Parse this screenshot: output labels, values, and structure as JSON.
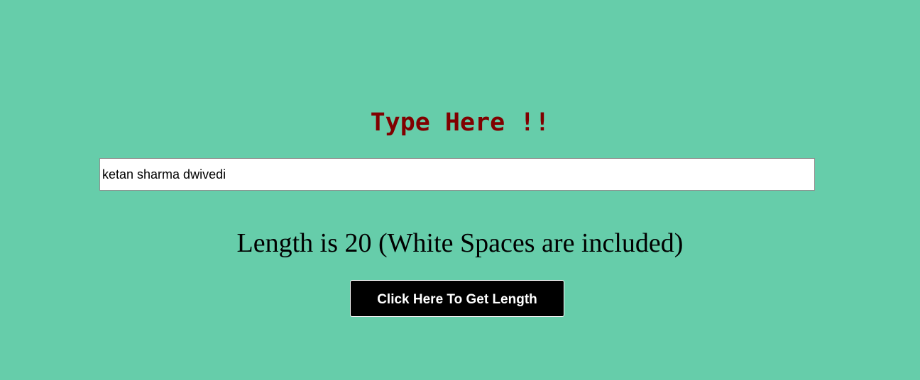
{
  "heading": "Type Here !!",
  "input": {
    "value": "ketan sharma dwivedi",
    "placeholder": ""
  },
  "result_text": "Length is 20 (White Spaces are included)",
  "button_label": "Click Here To Get Length",
  "colors": {
    "background": "#66cdaa",
    "heading": "#800000",
    "button_bg": "#000000",
    "button_text": "#ffffff"
  }
}
